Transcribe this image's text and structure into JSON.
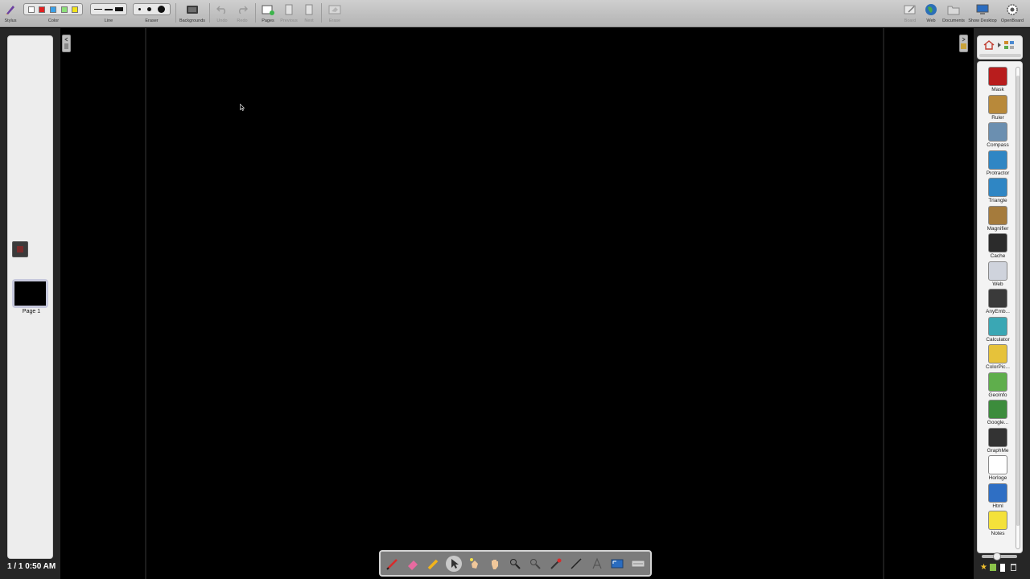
{
  "toolbar": {
    "stylus_label": "Stylus",
    "color_label": "Color",
    "line_label": "Line",
    "eraser_label": "Eraser",
    "backgrounds_label": "Backgrounds",
    "undo_label": "Undo",
    "redo_label": "Redo",
    "pages_label": "Pages",
    "previous_label": "Previous",
    "next_label": "Next",
    "erase_label": "Erase",
    "board_label": "Board",
    "web_label": "Web",
    "documents_label": "Documents",
    "show_desktop_label": "Show Desktop",
    "openboard_label": "OpenBoard",
    "colors": [
      "#ffffff",
      "#e32020",
      "#3aa0e8",
      "#8ee07a",
      "#f2e31b"
    ]
  },
  "thumbnails": {
    "page_label": "Page 1",
    "counter": "1 / 1  0:50 AM"
  },
  "library": {
    "items": [
      {
        "label": "Mask",
        "icon": "mask-icon",
        "color": "#b81d1d"
      },
      {
        "label": "Ruler",
        "icon": "ruler-icon",
        "color": "#b8893a"
      },
      {
        "label": "Compass",
        "icon": "compass-icon",
        "color": "#6b8fb0"
      },
      {
        "label": "Protractor",
        "icon": "protractor-icon",
        "color": "#2f86c4"
      },
      {
        "label": "Triangle",
        "icon": "triangle-icon",
        "color": "#2f86c4"
      },
      {
        "label": "Magnifier",
        "icon": "magnifier-icon",
        "color": "#a57b3c"
      },
      {
        "label": "Cache",
        "icon": "cache-icon",
        "color": "#2b2b2b"
      },
      {
        "label": "Web",
        "icon": "folder-icon",
        "color": "#cfd3dc"
      },
      {
        "label": "AnyEmb...",
        "icon": "anyembed-icon",
        "color": "#3a3a3a"
      },
      {
        "label": "Calculator",
        "icon": "calculator-icon",
        "color": "#3aa7b4"
      },
      {
        "label": "ColorPic...",
        "icon": "colorpicker-icon",
        "color": "#e6c23a"
      },
      {
        "label": "GeoInfo",
        "icon": "geoinfo-icon",
        "color": "#5fae4c"
      },
      {
        "label": "Google...",
        "icon": "googlemap-icon",
        "color": "#3c8c3c"
      },
      {
        "label": "GraphMe",
        "icon": "graphme-icon",
        "color": "#333333"
      },
      {
        "label": "Horloge",
        "icon": "clock-icon",
        "color": "#ffffff"
      },
      {
        "label": "Html",
        "icon": "html-icon",
        "color": "#2f6fc4"
      },
      {
        "label": "Notes",
        "icon": "notes-icon",
        "color": "#f4e13a"
      }
    ]
  },
  "palette": {
    "tools": [
      "pen-icon",
      "eraser-icon",
      "marker-icon",
      "selector-icon",
      "interact-icon",
      "hand-icon",
      "zoom-in-icon",
      "zoom-out-icon",
      "laser-icon",
      "line-icon",
      "text-icon",
      "capture-icon",
      "keyboard-icon"
    ]
  }
}
